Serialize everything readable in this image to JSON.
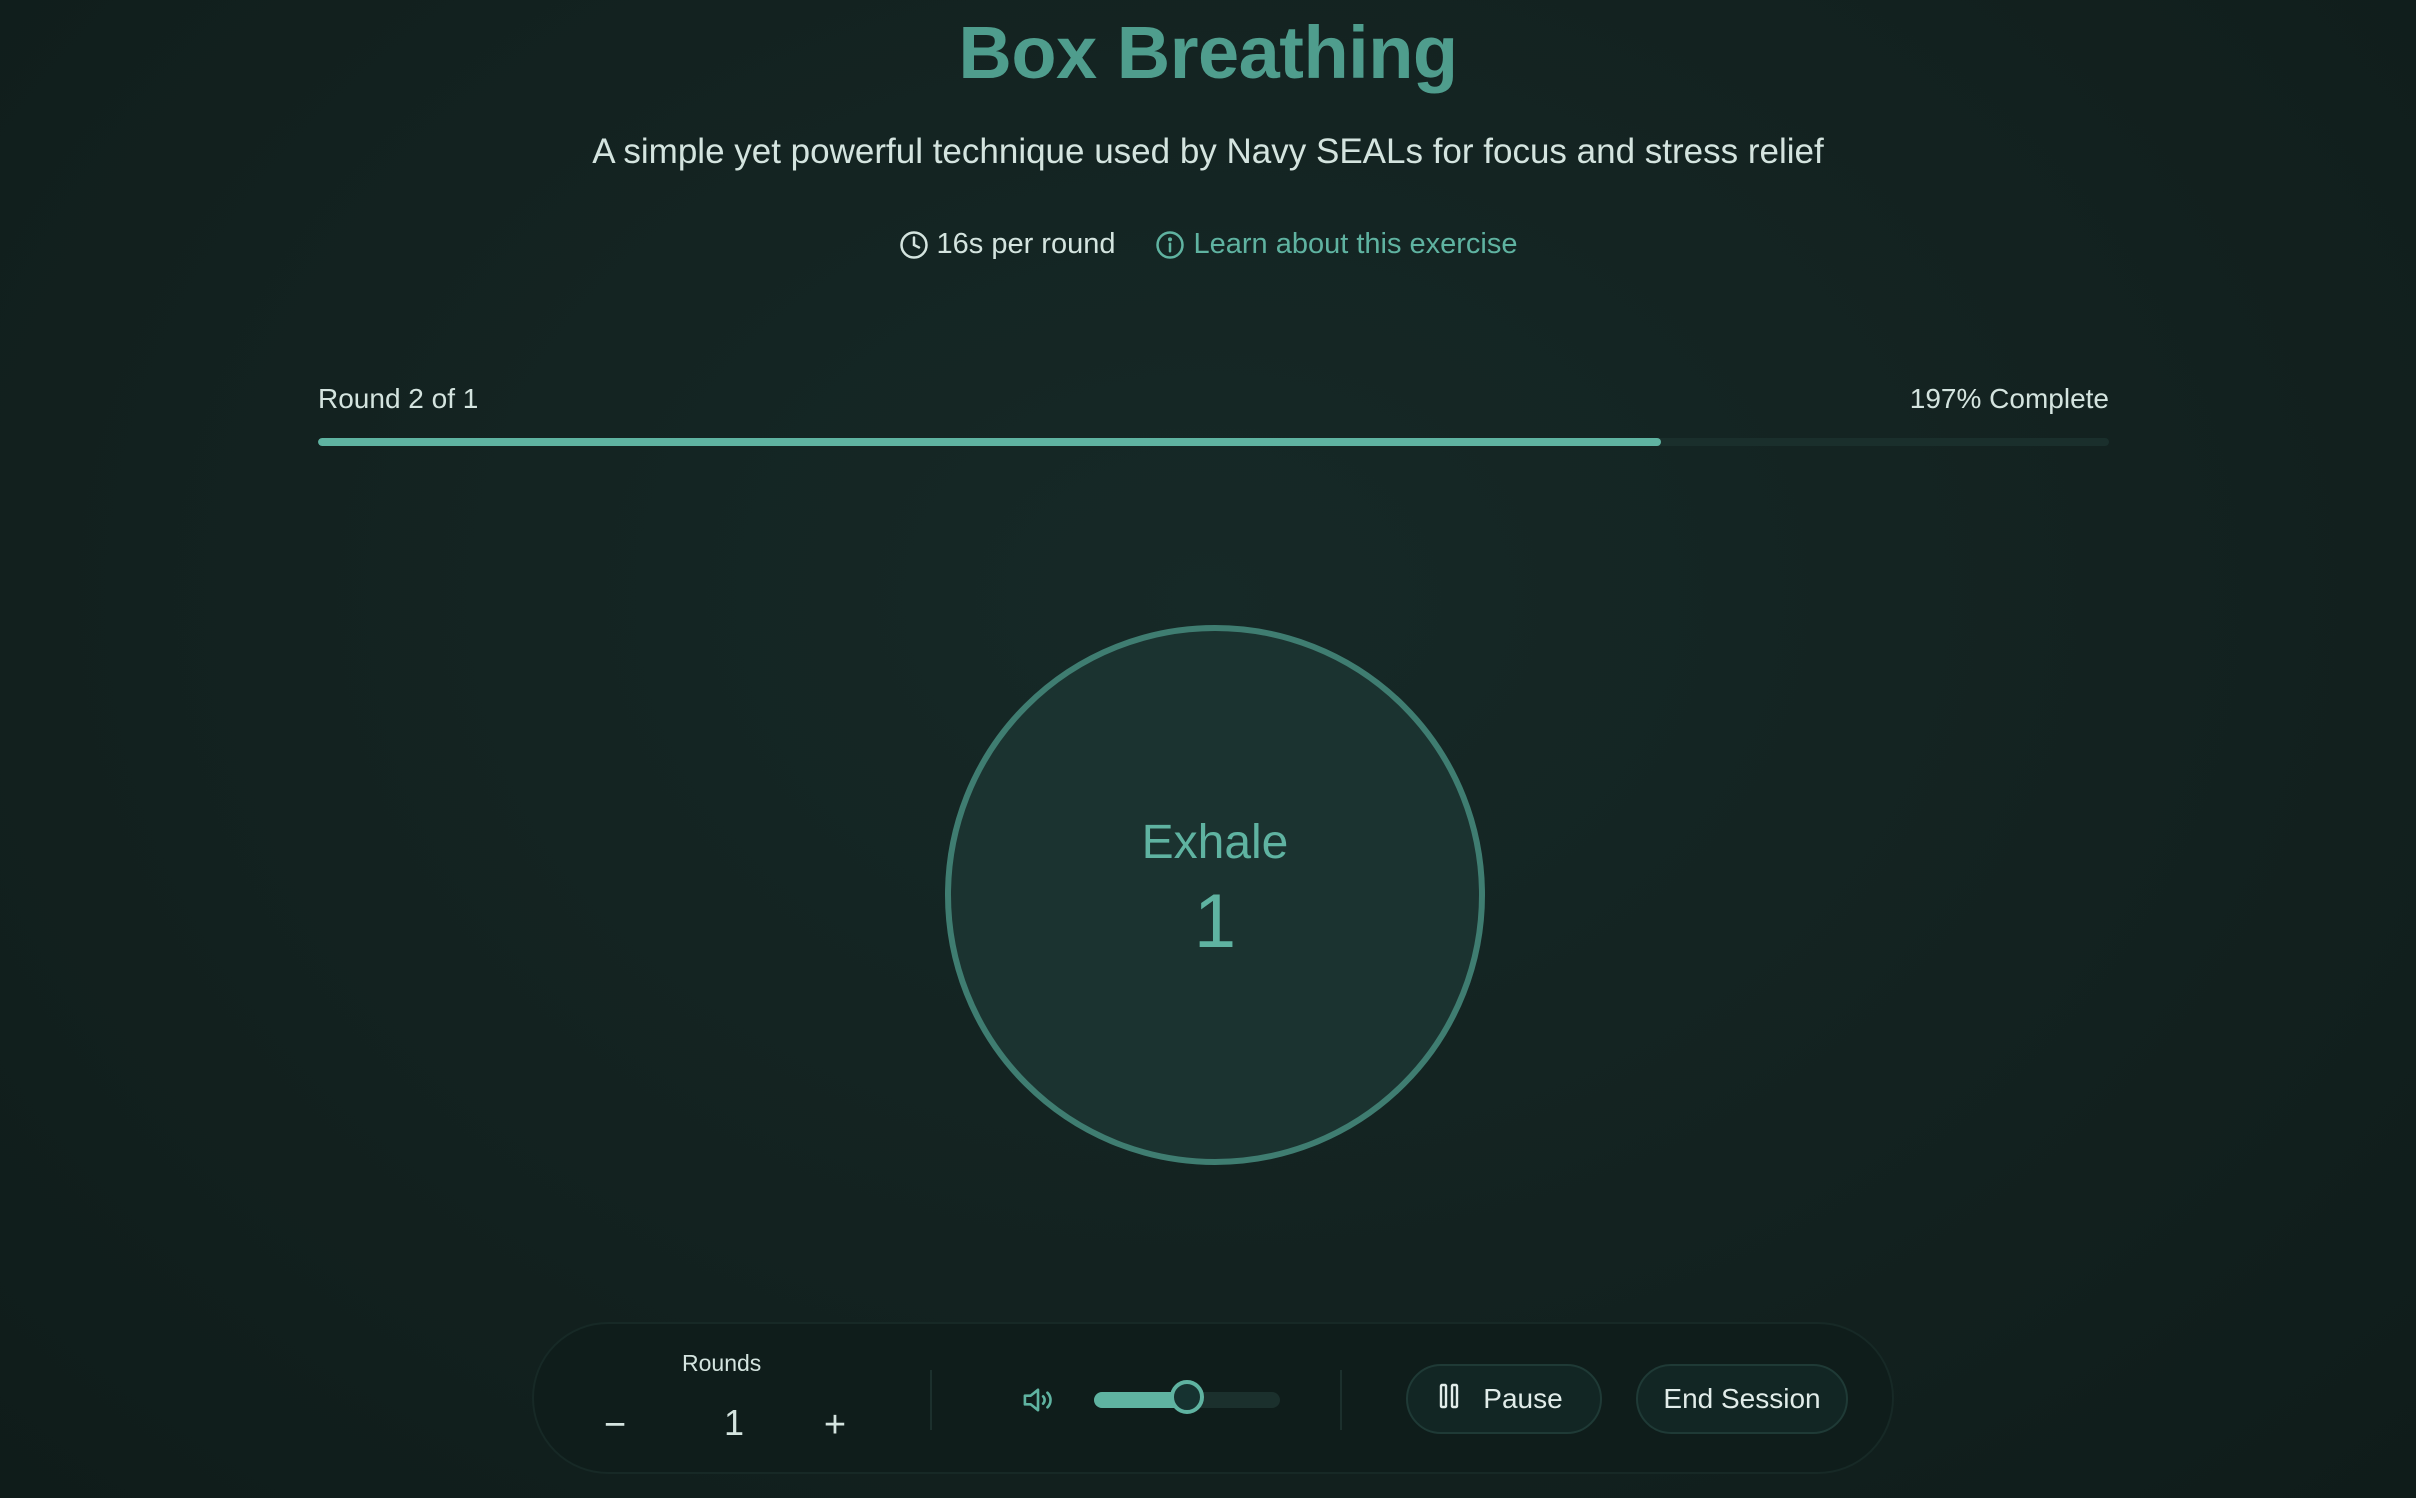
{
  "header": {
    "title": "Box Breathing",
    "subtitle": "A simple yet powerful technique used by Navy SEALs for focus and stress relief"
  },
  "meta": {
    "duration_icon": "clock-icon",
    "duration_label": "16s per round",
    "learn_icon": "info-icon",
    "learn_label": "Learn about this exercise"
  },
  "progress": {
    "round_label": "Round 2 of 1",
    "complete_label": "197% Complete",
    "fill_fraction": 0.75
  },
  "breath": {
    "phase": "Exhale",
    "count": "1"
  },
  "controls": {
    "rounds_label": "Rounds",
    "decrement_symbol": "−",
    "increment_symbol": "+",
    "rounds_value": "1",
    "volume_icon": "speaker-icon",
    "volume_level": 0.5,
    "pause_icon": "pause-icon",
    "pause_label": "Pause",
    "end_label": "End Session"
  },
  "colors": {
    "accent": "#5fb3a1",
    "title": "#4f9d8d",
    "background": "#132220",
    "circle_fill": "#1b3330",
    "circle_border": "#3f7d71"
  }
}
